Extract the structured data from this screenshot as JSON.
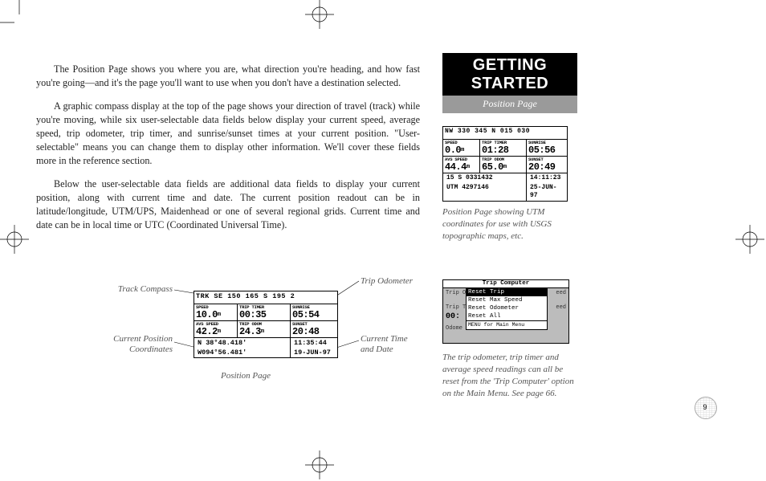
{
  "header": {
    "title": "GETTING STARTED",
    "subtitle": "Position Page"
  },
  "body": {
    "p1": "The Position Page shows you where you are, what direction you're heading, and how fast you're going—and it's the page you'll want to use when you don't have a destination selected.",
    "p2": "A graphic compass display at the top of the page shows your direction of travel (track) while you're moving, while six user-selectable data fields below display your current speed, average speed, trip odometer, trip timer, and sunrise/sunset times at your current position. \"User-selectable\" means you can change them to display other information. We'll cover these fields more in the reference section.",
    "p3": "Below the user-selectable data fields are additional data fields to display your current position, along with current time and date. The current position readout can be in latitude/longitude, UTM/UPS, Maidenhead or one of several regional grids. Current time and date can be in local time or UTC (Coordinated Universal Time)."
  },
  "diagram": {
    "labels": {
      "track_compass": "Track Compass",
      "trip_odometer": "Trip Odometer",
      "cur_pos": "Current Position\nCoordinates",
      "cur_time": "Current Time\nand Date",
      "caption": "Position Page"
    },
    "lcd": {
      "compass": "TRK SE  150  165   S   195  2",
      "speed_l": "SPEED",
      "speed_v": "10.0",
      "triptimer_l": "TRIP TIMER",
      "triptimer_v": "00:35",
      "sunrise_l": "SUNRISE",
      "sunrise_v": "05:54",
      "avs_l": "AVS SPEED",
      "avs_v": "42.2",
      "tripodom_l": "TRIP ODOM",
      "tripodom_v": "24.3",
      "sunset_l": "SUNSET",
      "sunset_v": "20:48",
      "pos1a": "N  38°48.418'",
      "pos1b": "11:35:44",
      "pos2a": "W094°56.481'",
      "pos2b": "19-JUN-97"
    }
  },
  "side1": {
    "lcd": {
      "compass": "NW  330  345   N   015  030",
      "speed_l": "SPEED",
      "speed_v": "0.0",
      "triptimer_l": "TRIP TIMER",
      "triptimer_v": "01:28",
      "sunrise_l": "SUNRISE",
      "sunrise_v": "05:56",
      "avs_l": "AVS SPEED",
      "avs_v": "44.4",
      "tripodom_l": "TRIP ODOM",
      "tripodom_v": "65.0",
      "sunset_l": "SUNSET",
      "sunset_v": "20:49",
      "pos1a": "15 S 0331432",
      "pos1b": "14:11:23",
      "pos2a": "UTM  4297146",
      "pos2b": "25-JUN-97"
    },
    "caption": "Position Page showing UTM coordinates for use with USGS topographic maps, etc."
  },
  "side2": {
    "popup": {
      "title": "Trip Computer",
      "item1": "Reset Trip",
      "item2": "Reset Max Speed",
      "item3": "Reset Odometer",
      "item4": "Reset All",
      "hint": "MENU for Main Menu"
    },
    "bg": {
      "c1": "Trip Od",
      "c2": "eed",
      "c3": "Trip Ti",
      "c4": "eed",
      "c5": "00:",
      "c6": "Odome"
    },
    "caption": "The trip odometer, trip timer and average speed readings can all be reset from the 'Trip Computer' option on the Main Menu. See page 66."
  },
  "page_number": "9"
}
